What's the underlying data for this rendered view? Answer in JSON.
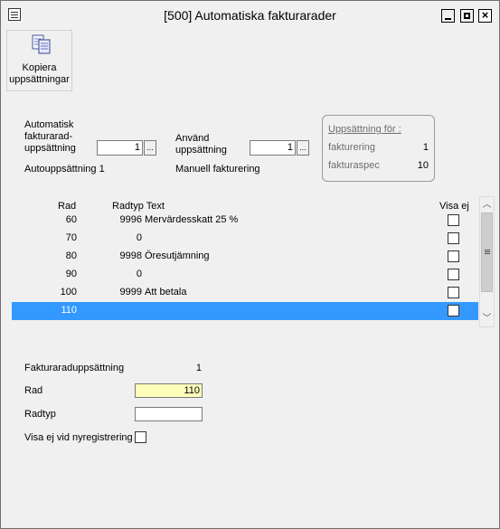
{
  "window": {
    "title": "[500]  Automatiska fakturarader",
    "close_glyph": "×"
  },
  "toolbar": {
    "copy_label_line1": "Kopiera",
    "copy_label_line2": "uppsättningar"
  },
  "auto_setup": {
    "label_line1": "Automatisk",
    "label_line2": "fakturarad-",
    "label_line3": "uppsättning",
    "value": "1",
    "sublabel": "Autouppsättning 1"
  },
  "use_setup": {
    "label_line1": "Använd",
    "label_line2": "uppsättning",
    "value": "1",
    "sublabel": "Manuell fakturering"
  },
  "group": {
    "title": "Uppsättning för :",
    "row1_label": "fakturering",
    "row1_value": "1",
    "row2_label": "fakturaspec",
    "row2_value": "10"
  },
  "grid": {
    "headers": {
      "rad": "Rad",
      "radtyp_text": "Radtyp Text",
      "visa_ej": "Visa ej"
    },
    "rows": [
      {
        "rad": "60",
        "radtyp": "9996",
        "text": "Mervärdesskatt 25 %",
        "visa_ej": false
      },
      {
        "rad": "70",
        "radtyp": "0",
        "text": "",
        "visa_ej": false
      },
      {
        "rad": "80",
        "radtyp": "9998",
        "text": "Öresutjämning",
        "visa_ej": false
      },
      {
        "rad": "90",
        "radtyp": "0",
        "text": "",
        "visa_ej": false
      },
      {
        "rad": "100",
        "radtyp": "9999",
        "text": "Att betala",
        "visa_ej": false
      },
      {
        "rad": "110",
        "radtyp": "",
        "text": "",
        "visa_ej": false,
        "selected": true
      }
    ]
  },
  "detail": {
    "setup_label": "Fakturaraduppsättning",
    "setup_value": "1",
    "rad_label": "Rad",
    "rad_value": "110",
    "radtyp_label": "Radtyp",
    "radtyp_value": "",
    "visa_ej_label": "Visa ej vid nyregistrering",
    "visa_ej_checked": false
  },
  "colors": {
    "selection": "#3399ff",
    "active_field": "#ffffbb"
  }
}
